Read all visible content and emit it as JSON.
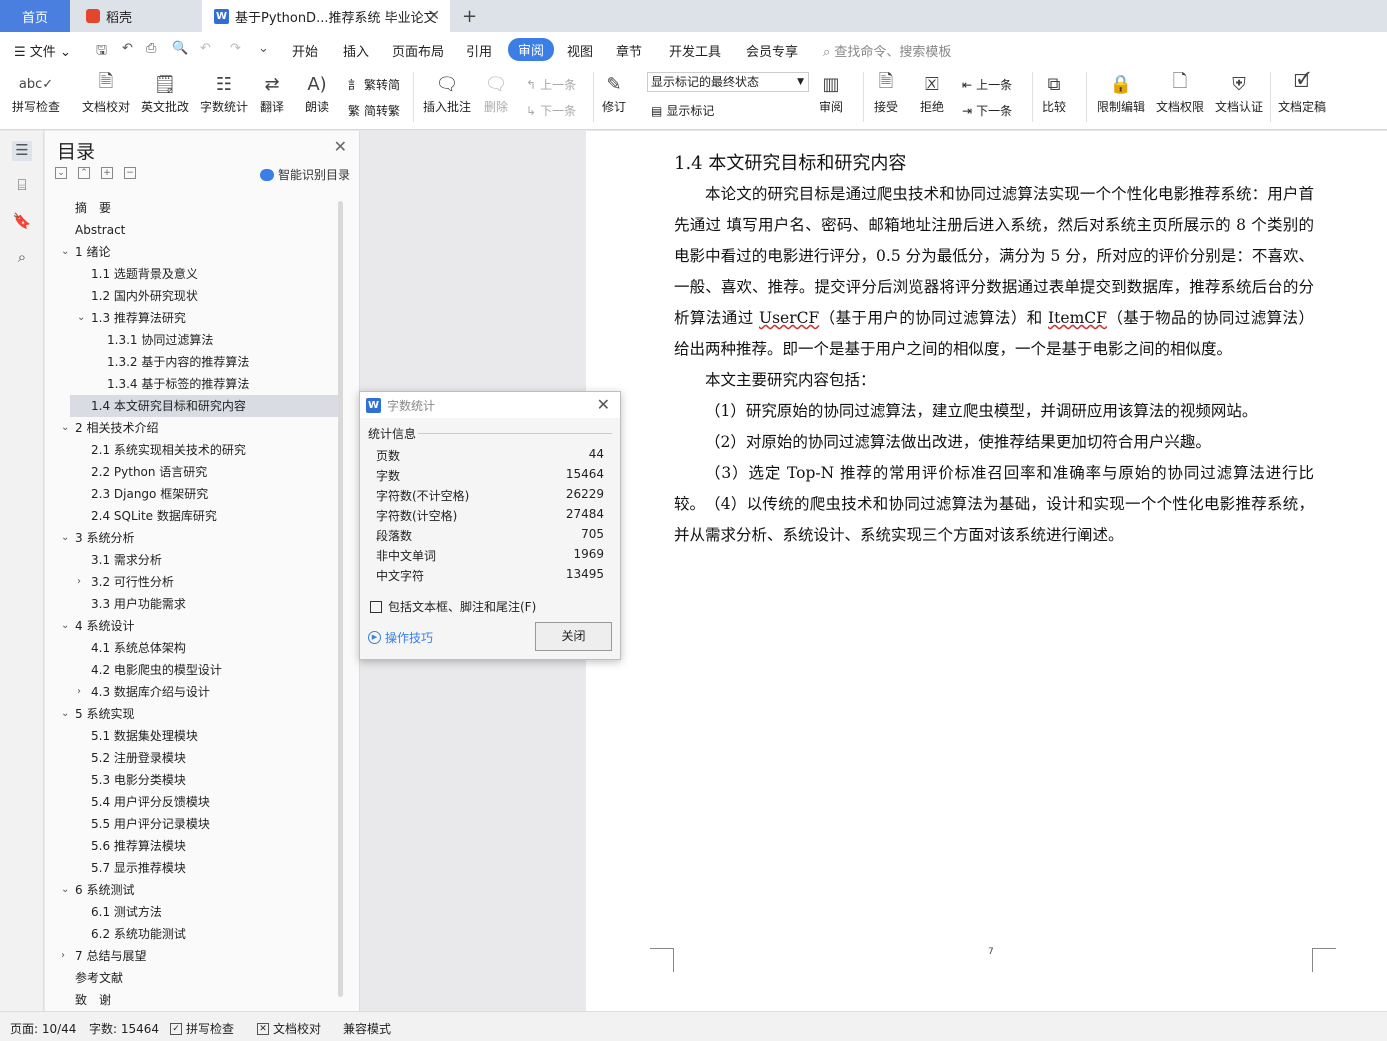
{
  "tabs": {
    "home": "首页",
    "daoke": "稻壳",
    "doc": "基于PythonD...推荐系统 毕业论文",
    "doc_icon": "W"
  },
  "menu": {
    "file": "文件",
    "items": [
      "开始",
      "插入",
      "页面布局",
      "引用",
      "审阅",
      "视图",
      "章节",
      "开发工具",
      "会员专享"
    ],
    "search_placeholder": "查找命令、搜索模板"
  },
  "toolbar": {
    "spell": "拼写检查",
    "proof": "文档校对",
    "en_review": "英文批改",
    "word_count": "字数统计",
    "translate": "翻译",
    "read_aloud": "朗读",
    "trad": "繁转简",
    "simp": "简转繁",
    "insert_comment": "插入批注",
    "delete": "删除",
    "prev": "上一条",
    "next": "下一条",
    "revise": "修订",
    "markup_state": "显示标记的最终状态",
    "show_markup": "显示标记",
    "review": "审阅",
    "accept": "接受",
    "reject": "拒绝",
    "prev2": "上一条",
    "next2": "下一条",
    "compare": "比较",
    "restrict": "限制编辑",
    "permission": "文档权限",
    "certify": "文档认证",
    "finalize": "文档定稿"
  },
  "toc": {
    "title": "目录",
    "smart": "智能识别目录",
    "items": [
      {
        "level": 1,
        "text": "摘　要",
        "caret": ""
      },
      {
        "level": 1,
        "text": "Abstract",
        "caret": ""
      },
      {
        "level": 1,
        "text": "1 绪论",
        "caret": "v"
      },
      {
        "level": 2,
        "text": "1.1 选题背景及意义",
        "caret": ""
      },
      {
        "level": 2,
        "text": "1.2 国内外研究现状",
        "caret": ""
      },
      {
        "level": 2,
        "text": "1.3 推荐算法研究",
        "caret": "v"
      },
      {
        "level": 3,
        "text": "1.3.1 协同过滤算法",
        "caret": ""
      },
      {
        "level": 3,
        "text": "1.3.2 基于内容的推荐算法",
        "caret": ""
      },
      {
        "level": 3,
        "text": "1.3.4 基于标签的推荐算法",
        "caret": ""
      },
      {
        "level": 2,
        "text": "1.4 本文研究目标和研究内容",
        "caret": "",
        "selected": true
      },
      {
        "level": 1,
        "text": "2 相关技术介绍",
        "caret": "v"
      },
      {
        "level": 2,
        "text": "2.1 系统实现相关技术的研究",
        "caret": ""
      },
      {
        "level": 2,
        "text": "2.2 Python 语言研究",
        "caret": ""
      },
      {
        "level": 2,
        "text": "2.3 Django 框架研究",
        "caret": ""
      },
      {
        "level": 2,
        "text": "2.4 SQLite 数据库研究",
        "caret": ""
      },
      {
        "level": 1,
        "text": "3 系统分析",
        "caret": "v"
      },
      {
        "level": 2,
        "text": "3.1 需求分析",
        "caret": ""
      },
      {
        "level": 2,
        "text": "3.2 可行性分析",
        "caret": ">"
      },
      {
        "level": 2,
        "text": "3.3 用户功能需求",
        "caret": ""
      },
      {
        "level": 1,
        "text": "4 系统设计",
        "caret": "v"
      },
      {
        "level": 2,
        "text": "4.1 系统总体架构",
        "caret": ""
      },
      {
        "level": 2,
        "text": "4.2 电影爬虫的模型设计",
        "caret": ""
      },
      {
        "level": 2,
        "text": "4.3 数据库介绍与设计",
        "caret": ">"
      },
      {
        "level": 1,
        "text": "5 系统实现",
        "caret": "v"
      },
      {
        "level": 2,
        "text": "5.1 数据集处理模块",
        "caret": ""
      },
      {
        "level": 2,
        "text": "5.2 注册登录模块",
        "caret": ""
      },
      {
        "level": 2,
        "text": "5.3 电影分类模块",
        "caret": ""
      },
      {
        "level": 2,
        "text": "5.4 用户评分反馈模块",
        "caret": ""
      },
      {
        "level": 2,
        "text": "5.5 用户评分记录模块",
        "caret": ""
      },
      {
        "level": 2,
        "text": "5.6 推荐算法模块",
        "caret": ""
      },
      {
        "level": 2,
        "text": "5.7 显示推荐模块",
        "caret": ""
      },
      {
        "level": 1,
        "text": "6 系统测试",
        "caret": "v"
      },
      {
        "level": 2,
        "text": "6.1 测试方法",
        "caret": ""
      },
      {
        "level": 2,
        "text": "6.2 系统功能测试",
        "caret": ""
      },
      {
        "level": 1,
        "text": "7 总结与展望",
        "caret": ">"
      },
      {
        "level": 1,
        "text": "参考文献",
        "caret": ""
      },
      {
        "level": 1,
        "text": "致　谢",
        "caret": ""
      }
    ]
  },
  "doc": {
    "heading": "1.4 本文研究目标和研究内容",
    "p1_a": "本论文的研究目标是通过爬虫技术和协同过滤算法实现一个个性化电影推荐系统：用户首先通过 填写用户名、密码、邮箱地址注册后进入系统，然后对系统主页所展示的 8 个类别的电影中看过的电影进行评分，0.5 分为最低分，满分为 5 分，所对应的评价分别是：不喜欢、一般、喜欢、推荐。提交评分后浏览器将评分数据通过表单提交到数据库，推荐系统后台的分析算法通过 ",
    "p1_usercf": "UserCF",
    "p1_b": "（基于用户的协同过滤算法）和 ",
    "p1_itemcf": "ItemCF",
    "p1_c": "（基于物品的协同过滤算法）给出两种推荐。即一个是基于用户之间的相似度，一个是基于电影之间的相似度。",
    "p2": "本文主要研究内容包括：",
    "p3": "（1）研究原始的协同过滤算法，建立爬虫模型，并调研应用该算法的视频网站。",
    "p4": "（2）对原始的协同过滤算法做出改进，使推荐结果更加切符合用户兴趣。",
    "p5": "（3）选定 Top-N 推荐的常用评价标准召回率和准确率与原始的协同过滤算法进行比较。",
    "p6": "（4）以传统的爬虫技术和协同过滤算法为基础，设计和实现一个个性化电影推荐系统，并从需求分析、系统设计、系统实现三个方面对该系统进行阐述。",
    "page_number": "7"
  },
  "dialog": {
    "title": "字数统计",
    "section": "统计信息",
    "rows": [
      {
        "label": "页数",
        "value": "44"
      },
      {
        "label": "字数",
        "value": "15464"
      },
      {
        "label": "字符数(不计空格)",
        "value": "26229"
      },
      {
        "label": "字符数(计空格)",
        "value": "27484"
      },
      {
        "label": "段落数",
        "value": "705"
      },
      {
        "label": "非中文单词",
        "value": "1969"
      },
      {
        "label": "中文字符",
        "value": "13495"
      }
    ],
    "include_label": "包括文本框、脚注和尾注(F)",
    "tips": "操作技巧",
    "close": "关闭"
  },
  "status": {
    "page": "页面: 10/44",
    "words": "字数: 15464",
    "spell": "拼写检查",
    "proof": "文档校对",
    "compat": "兼容模式"
  },
  "colors": {
    "accent": "#3a7ee6",
    "home_tab": "#4a7fe0",
    "toc_selected": "#d9dde3"
  }
}
